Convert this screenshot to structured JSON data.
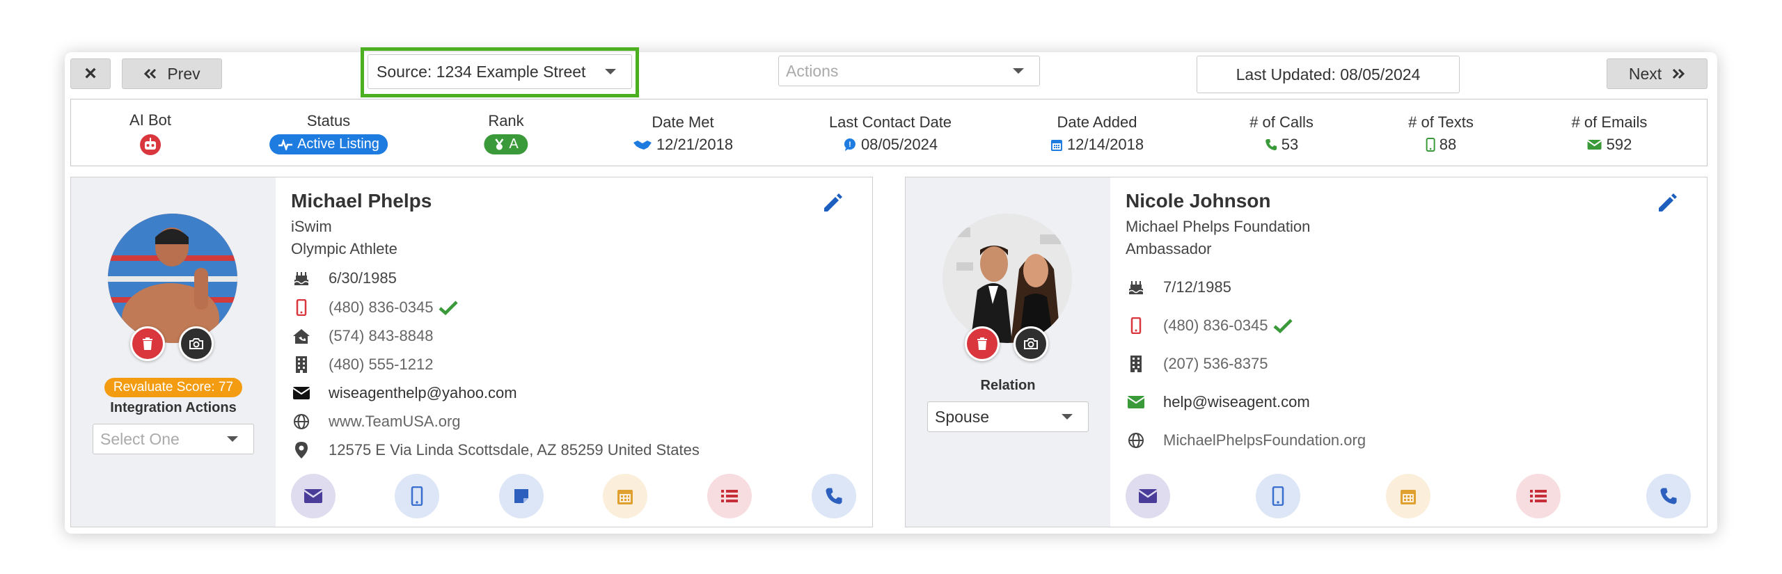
{
  "toolbar": {
    "close_glyph": "×",
    "prev_label": "Prev",
    "source_label": "Source: 1234 Example Street",
    "actions_placeholder": "Actions",
    "last_updated": "Last Updated: 08/05/2024",
    "next_label": "Next"
  },
  "stats": [
    {
      "label": "AI Bot",
      "value": ""
    },
    {
      "label": "Status",
      "value": "Active Listing"
    },
    {
      "label": "Rank",
      "value": "A"
    },
    {
      "label": "Date Met",
      "value": "12/21/2018"
    },
    {
      "label": "Last Contact Date",
      "value": "08/05/2024"
    },
    {
      "label": "Date Added",
      "value": "12/14/2018"
    },
    {
      "label": "# of Calls",
      "value": "53"
    },
    {
      "label": "# of Texts",
      "value": "88"
    },
    {
      "label": "# of Emails",
      "value": "592"
    }
  ],
  "primary": {
    "name": "Michael Phelps",
    "company": "iSwim",
    "title": "Olympic Athlete",
    "birthday": "6/30/1985",
    "mobile": "(480) 836-0345",
    "home": "(574) 843-8848",
    "work": "(480) 555-1212",
    "email": "wiseagenthelp@yahoo.com",
    "website": "www.TeamUSA.org",
    "address": "12575 E Via Linda Scottsdale, AZ 85259 United States",
    "score_badge": "Revaluate Score: 77",
    "integration_label": "Integration Actions",
    "integration_placeholder": "Select One"
  },
  "secondary": {
    "name": "Nicole Johnson",
    "company": "Michael Phelps Foundation",
    "title": "Ambassador",
    "birthday": "7/12/1985",
    "mobile": "(480) 836-0345",
    "work": "(207) 536-8375",
    "email": "help@wiseagent.com",
    "website": "MichaelPhelpsFoundation.org",
    "relation_label": "Relation",
    "relation_value": "Spouse"
  },
  "colors": {
    "green_highlight": "#4caf1f",
    "status_blue": "#1e7be0",
    "rank_green": "#3a9a3a",
    "delete_red": "#d9363e",
    "camera_dark": "#2f2f2f",
    "score_orange": "#f39c12",
    "edit_blue": "#1d5fbf"
  }
}
